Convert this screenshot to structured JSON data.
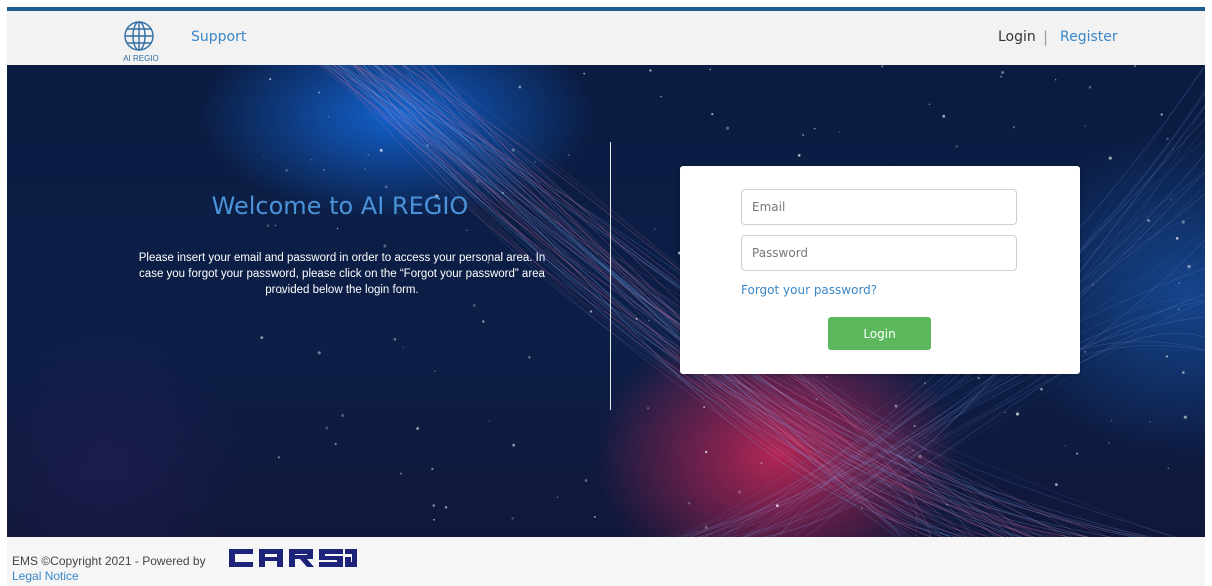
{
  "header": {
    "logo_text": "AI REGIO",
    "support_label": "Support",
    "login_label": "Login",
    "separator": "|",
    "register_label": "Register"
  },
  "hero": {
    "title": "Welcome to AI REGIO",
    "description": "Please insert your email and password in order to access your personal area. In case you forgot your password, please click on the “Forgot your password” area provided below the login form."
  },
  "login_form": {
    "email_placeholder": "Email",
    "email_value": "",
    "password_placeholder": "Password",
    "password_value": "",
    "forgot_label": "Forgot your password?",
    "submit_label": "Login"
  },
  "footer": {
    "copyright": "EMS ©Copyright 2021 - Powered by",
    "brand_logo_text": "CARSA",
    "legal_label": "Legal Notice"
  },
  "colors": {
    "accent_blue": "#3a87c8",
    "header_border": "#1f5c8e",
    "login_green": "#5cb85c",
    "brand_navy": "#1c2378",
    "hero_bg": "#0b1c42"
  }
}
